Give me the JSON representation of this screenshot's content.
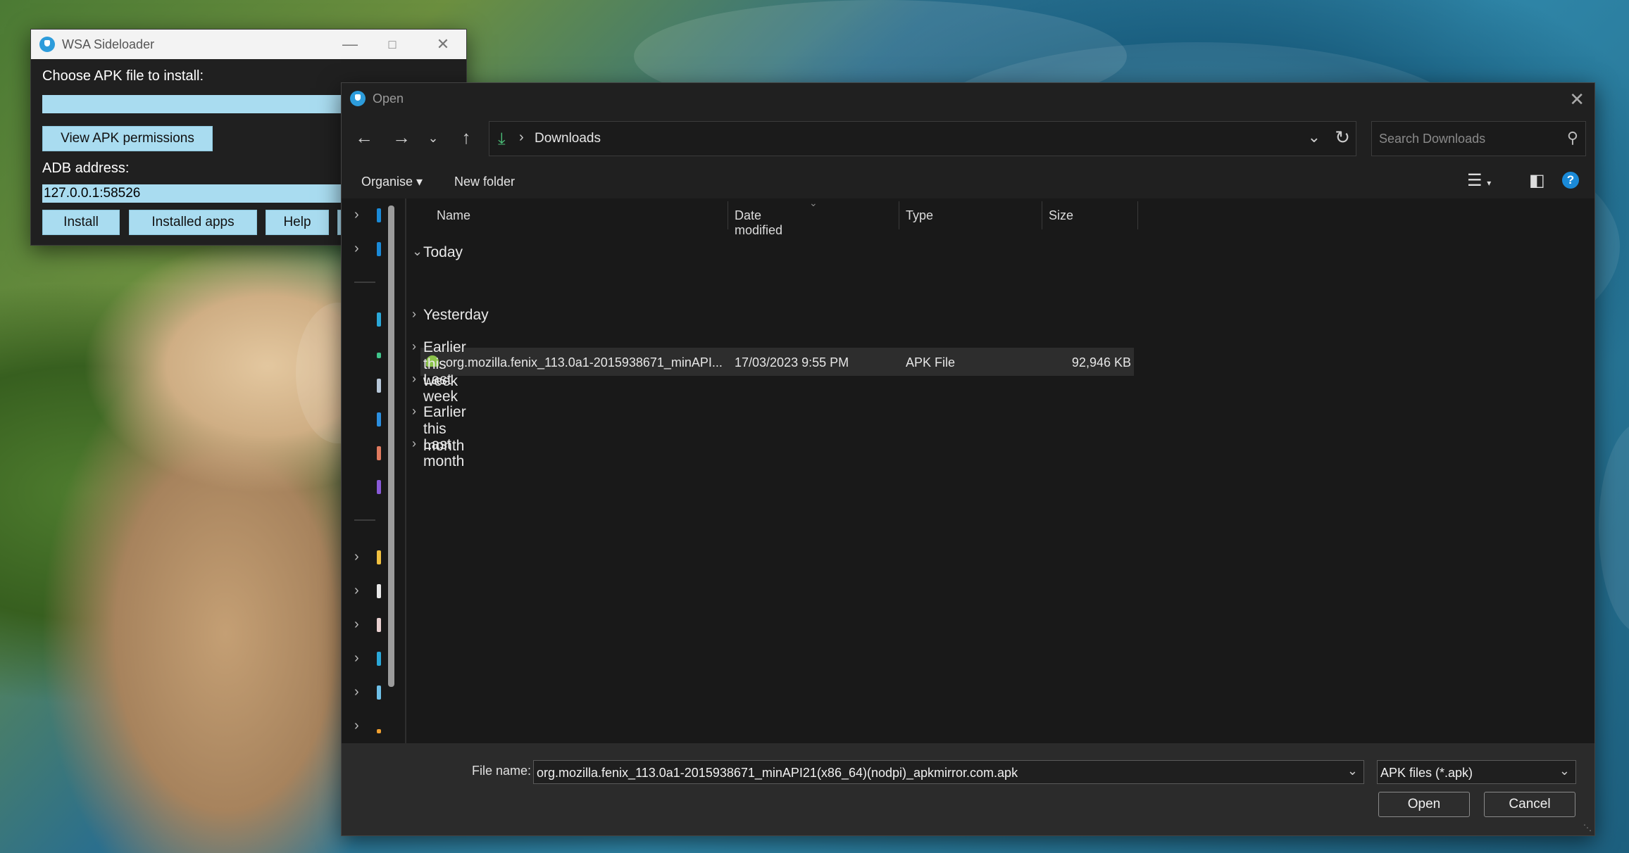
{
  "sideloader": {
    "title": "WSA Sideloader",
    "choose_label": "Choose APK file to install:",
    "apk_path": "",
    "view_permissions_label": "View APK permissions",
    "adb_label": "ADB address:",
    "adb_value": "127.0.0.1:58526",
    "install_label": "Install",
    "installed_apps_label": "Installed apps",
    "help_label": "Help"
  },
  "dialog": {
    "title": "Open",
    "breadcrumb": "Downloads",
    "search_placeholder": "Search Downloads",
    "organise_label": "Organise",
    "new_folder_label": "New folder",
    "columns": {
      "name": "Name",
      "date": "Date modified",
      "type": "Type",
      "size": "Size"
    },
    "groups": [
      "Today",
      "Yesterday",
      "Earlier this week",
      "Last week",
      "Earlier this month",
      "Last month"
    ],
    "file": {
      "name": "org.mozilla.fenix_113.0a1-2015938671_minAPI...",
      "date": "17/03/2023 9:55 PM",
      "type": "APK File",
      "size": "92,946 KB"
    },
    "file_name_label": "File name:",
    "file_name_value": "org.mozilla.fenix_113.0a1-2015938671_minAPI21(x86_64)(nodpi)_apkmirror.com.apk",
    "file_type": "APK files (*.apk)",
    "open_label": "Open",
    "cancel_label": "Cancel"
  },
  "colors": {
    "accent": "#2d9cdb",
    "sideloader_field": "#a9dcf0",
    "dialog_bg": "#191919",
    "download_icon": "#4cc27a"
  }
}
